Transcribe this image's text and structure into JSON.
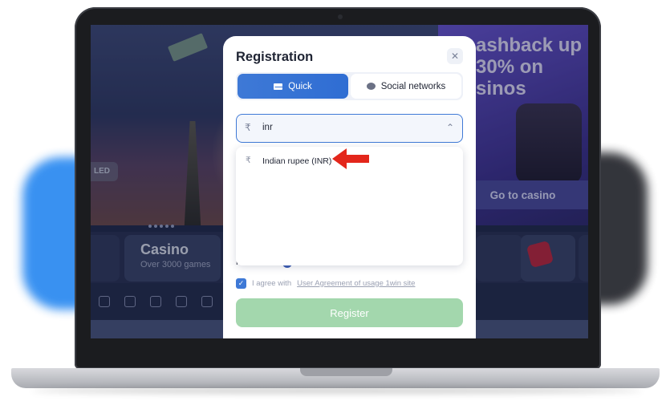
{
  "background": {
    "badge_text": "LED",
    "casino_card": {
      "title": "Casino",
      "subtitle": "Over 3000 games"
    },
    "promo": {
      "headline": "ashback up 30% on sinos",
      "cta": "Go to casino"
    }
  },
  "modal": {
    "title": "Registration",
    "close_icon": "close-icon",
    "tabs": [
      {
        "label": "Quick",
        "icon": "envelope-icon",
        "active": true
      },
      {
        "label": "Social networks",
        "icon": "chat-bubble-icon",
        "active": false
      }
    ],
    "currency_input": {
      "symbol": "₹",
      "value": "inr"
    },
    "dropdown": {
      "options": [
        {
          "symbol": "₹",
          "label": "Indian rupee (INR)"
        }
      ]
    },
    "promocode_label": "Promocode",
    "agree": {
      "text": "I agree with",
      "link": "User Agreement of usage 1win site",
      "checked": true
    },
    "register_label": "Register"
  },
  "colors": {
    "accent_blue": "#3e79d6",
    "register_green": "#a3d7ad",
    "annotation_arrow": "#e3261b"
  }
}
